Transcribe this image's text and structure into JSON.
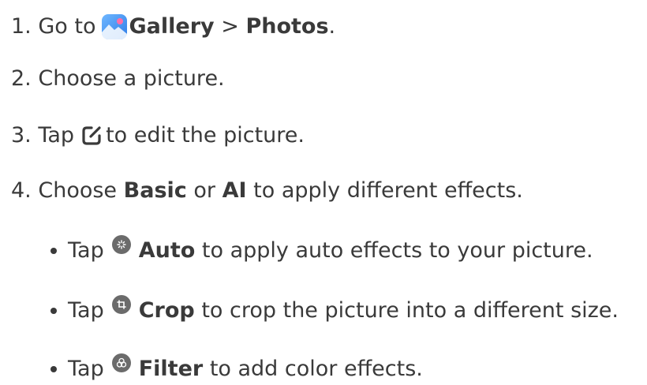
{
  "steps": [
    {
      "num": "1.",
      "pre": "Go to",
      "bold1": "Gallery",
      "mid": ">",
      "bold2": "Photos",
      "post": "."
    },
    {
      "num": "2.",
      "text": "Choose a picture."
    },
    {
      "num": "3.",
      "pre": "Tap",
      "post": "to edit the picture."
    },
    {
      "num": "4.",
      "pre": "Choose",
      "bold1": "Basic",
      "mid": "or",
      "bold2": "AI",
      "post": "to apply different effects."
    }
  ],
  "bullets": [
    {
      "pre": "Tap",
      "bold": "Auto",
      "post": "to apply auto effects to your picture.",
      "icon": "auto-effects-icon"
    },
    {
      "pre": "Tap",
      "bold": "Crop",
      "post": "to crop the picture into a different size.",
      "icon": "crop-icon"
    },
    {
      "pre": "Tap",
      "bold": "Filter",
      "post": "to add color effects.",
      "icon": "filter-icon"
    }
  ],
  "icons": {
    "gallery": "gallery-app-icon",
    "edit": "edit-icon"
  },
  "colors": {
    "text": "#3a3a3a",
    "icon_grey": "#6b6b6b",
    "gallery_blue": "#3f8ef5"
  }
}
